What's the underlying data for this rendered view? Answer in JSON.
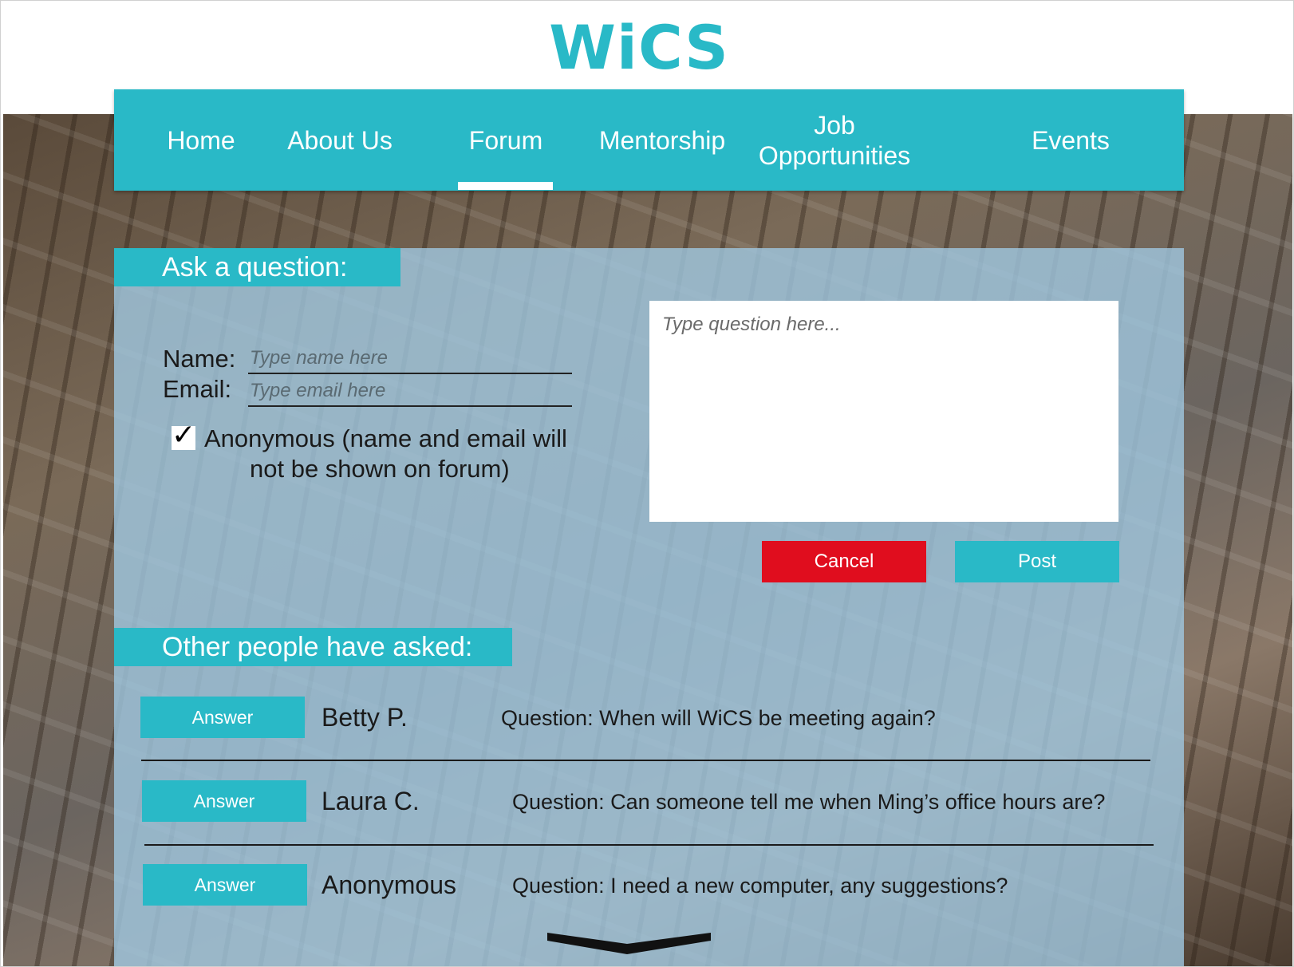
{
  "brand": {
    "logo_text": "WiCS",
    "accent_color": "#29b9c7"
  },
  "nav": {
    "items": [
      {
        "label": "Home"
      },
      {
        "label": "About Us"
      },
      {
        "label": "Forum",
        "active": true
      },
      {
        "label": "Mentorship"
      },
      {
        "label": "Job Opportunities"
      },
      {
        "label": "Events"
      }
    ]
  },
  "ask": {
    "heading": "Ask a question:",
    "name_label": "Name:",
    "name_placeholder": "Type name here",
    "email_label": "Email:",
    "email_placeholder": "Type email here",
    "anonymous_checked": true,
    "anonymous_check_glyph": "✓",
    "anonymous_label_line1": "Anonymous (name and email will",
    "anonymous_label_line2": "not be shown on forum)",
    "question_placeholder": "Type question here...",
    "cancel_label": "Cancel",
    "post_label": "Post",
    "cancel_color": "#e00d1e"
  },
  "others": {
    "heading": "Other people have asked:",
    "questions": [
      {
        "answer_label": "Answer",
        "asker": "Betty P.",
        "question": "Question: When will WiCS be meeting again?"
      },
      {
        "answer_label": "Answer",
        "asker": "Laura C.",
        "question": "Question: Can someone tell me when Ming’s office hours are?"
      },
      {
        "answer_label": "Answer",
        "asker": "Anonymous",
        "question": "Question: I need a new computer, any suggestions?"
      }
    ],
    "more_icon": "chevron-down-icon"
  }
}
